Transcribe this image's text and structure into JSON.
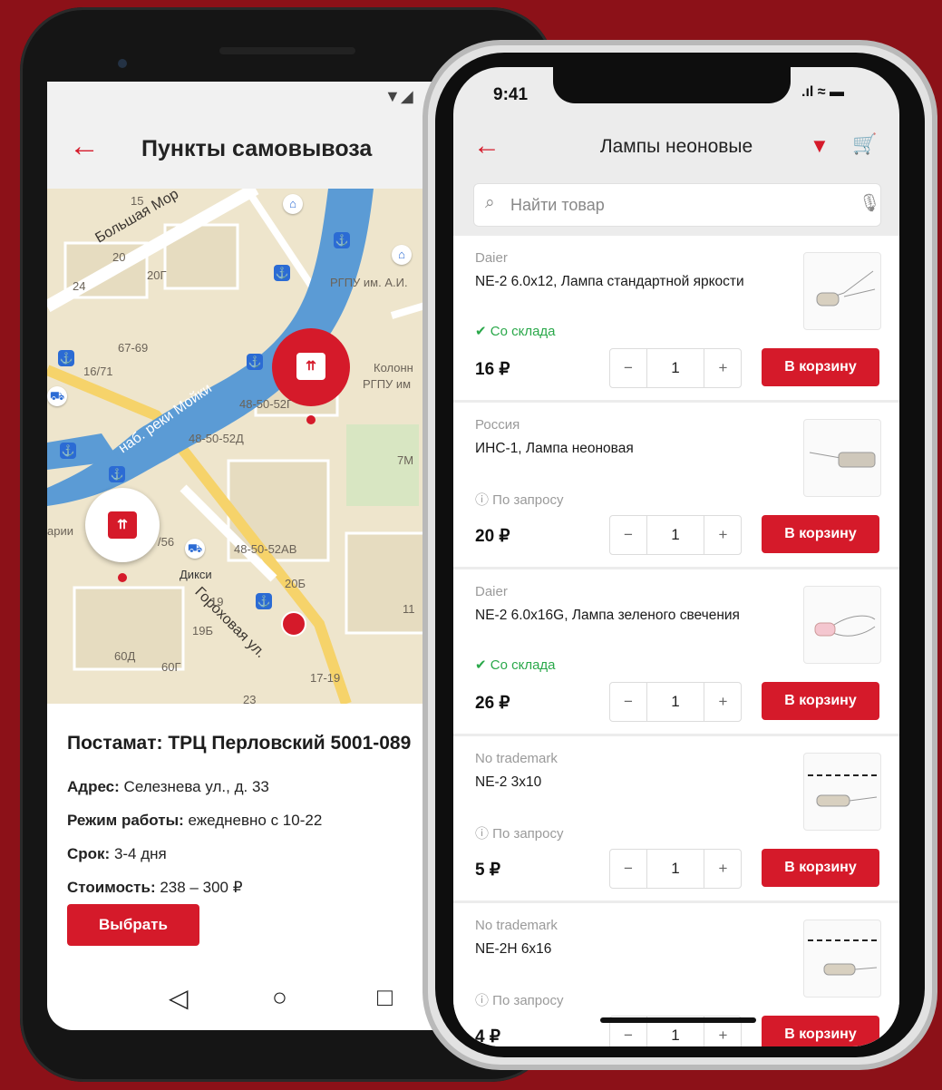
{
  "pickup": {
    "title": "Пункты самовывоза",
    "map": {
      "street_big": "Большая Мор",
      "street_moika": "наб. реки Мойки",
      "street_gorokh": "Гороховая ул.",
      "labels": [
        "15",
        "20",
        "20Г",
        "24",
        "67-69",
        "16/71",
        "48-50-52Г",
        "48-50-52Д",
        "/56",
        "48-50-52АВ",
        "Дикси",
        "19",
        "19Б",
        "20Б",
        "60Д",
        "60Г",
        "17-19",
        "23",
        "7М",
        "11",
        "РГПУ им. А.И.",
        "Колонн",
        "РГПУ им",
        "арии"
      ]
    },
    "point": {
      "name": "Постамат: ТРЦ Перловский 5001-089",
      "address_label": "Адрес:",
      "address": " Селезнева ул., д. 33",
      "hours_label": "Режим работы:",
      "hours": " ежедневно с 10-22",
      "term_label": "Срок:",
      "term": " 3-4 дня",
      "cost_label": "Стоимость:",
      "cost": " 238 – 300 ₽"
    },
    "select_label": "Выбрать"
  },
  "catalog": {
    "status_time": "9:41",
    "title": "Лампы неоновые",
    "search_placeholder": "Найти товар",
    "add_label": "В корзину",
    "products": [
      {
        "brand": "Daier",
        "name": "NE-2 6.0x12, Лампа стандартной яркости",
        "stock": "Со склада",
        "price": "16 ₽",
        "qty": "1"
      },
      {
        "brand": "Россия",
        "name": "ИНС-1, Лампа неоновая",
        "stock": "По запросу",
        "price": "20 ₽",
        "qty": "1"
      },
      {
        "brand": "Daier",
        "name": "NE-2 6.0x16G, Лампа зеленого свечения",
        "stock": "Со склада",
        "price": "26 ₽",
        "qty": "1"
      },
      {
        "brand": "No trademark",
        "name": "NE-2 3x10",
        "stock": "По запросу",
        "price": "5 ₽",
        "qty": "1"
      },
      {
        "brand": "No trademark",
        "name": "NE-2H 6x16",
        "stock": "По запросу",
        "price": "4 ₽",
        "qty": "1"
      }
    ]
  },
  "colors": {
    "accent": "#d51a2a",
    "background": "#8c1118",
    "in_stock": "#2aa84a"
  }
}
